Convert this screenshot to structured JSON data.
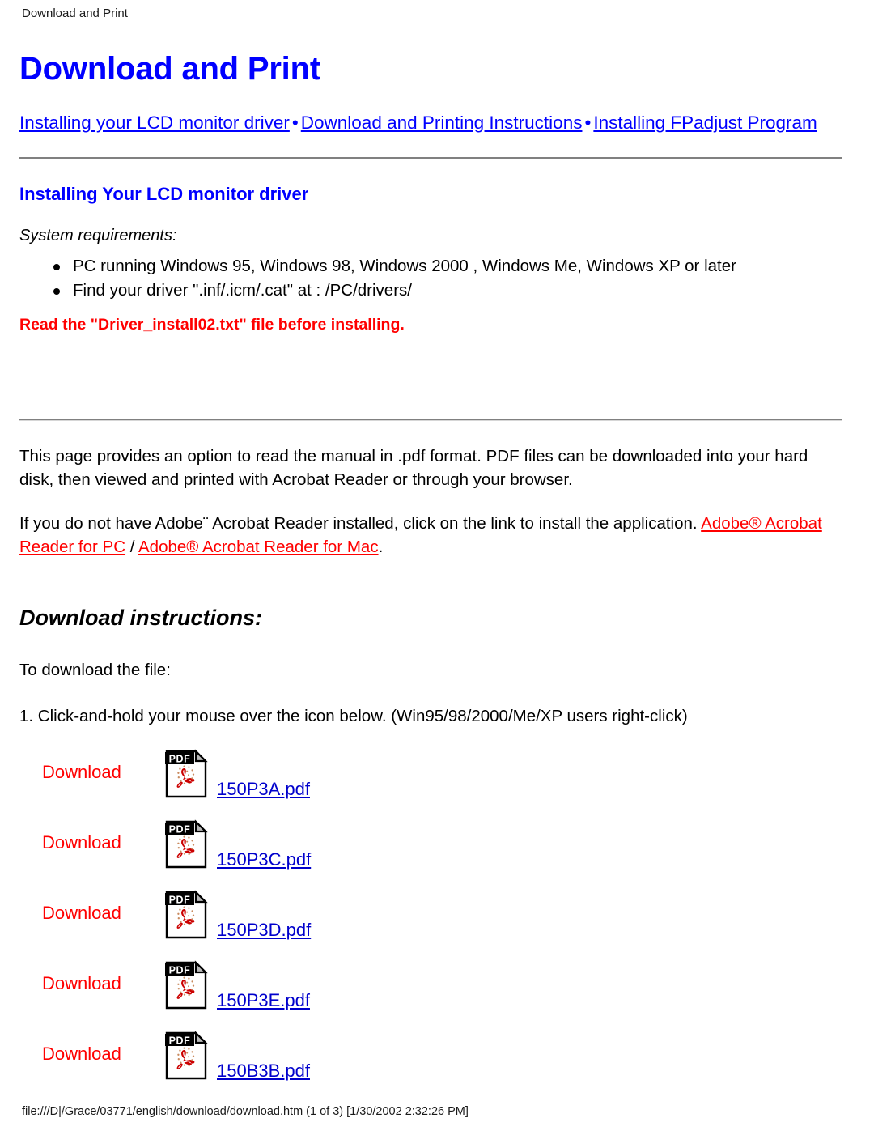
{
  "print_header": "Download and Print",
  "title": "Download and Print",
  "nav": {
    "separator": "•",
    "links": [
      "Installing your LCD monitor driver",
      "Download and Printing Instructions",
      "Installing FPadjust Program"
    ]
  },
  "driver_section": {
    "heading": "Installing Your LCD monitor driver",
    "system_requirements_label": "System requirements:",
    "requirements": [
      "PC running Windows 95, Windows 98, Windows 2000 , Windows Me, Windows XP or later",
      "Find your driver \".inf/.icm/.cat\" at : /PC/drivers/"
    ],
    "warning": "Read the \"Driver_install02.txt\" file before installing."
  },
  "intro": {
    "paragraph1": "This page provides an option to read the manual in .pdf format. PDF files can be downloaded into your hard disk, then viewed and printed with Acrobat Reader or through your browser.",
    "paragraph2_part1": "If you do not have Adobe¨ Acrobat Reader installed, click on the link to install the application. ",
    "link_pc": "Adobe® Acrobat Reader for PC",
    "paragraph2_mid": " / ",
    "link_mac": "Adobe® Acrobat Reader for Mac",
    "paragraph2_end": "."
  },
  "download_section": {
    "heading": "Download instructions:",
    "to_download": "To download the file:",
    "step1": "1. Click-and-hold your mouse over the icon below. (Win95/98/2000/Me/XP users right-click)",
    "download_label": "Download",
    "icon_name": "pdf-file-icon",
    "icon_banner_text": "PDF",
    "files": [
      {
        "label": "Download",
        "filename": "150P3A.pdf"
      },
      {
        "label": "Download",
        "filename": "150P3C.pdf"
      },
      {
        "label": "Download",
        "filename": "150P3D.pdf"
      },
      {
        "label": "Download",
        "filename": "150P3E.pdf"
      },
      {
        "label": "Download",
        "filename": "150B3B.pdf"
      }
    ]
  },
  "footer": "file:///D|/Grace/03771/english/download/download.htm (1 of 3) [1/30/2002 2:32:26 PM]",
  "colors": {
    "link_blue": "#0000FF",
    "heading_blue": "#0000FF",
    "warning_red": "#FF0000",
    "download_red": "#FF0000",
    "file_link_blue": "#0000CC",
    "rule_gray": "#808080",
    "text_black": "#000000"
  }
}
